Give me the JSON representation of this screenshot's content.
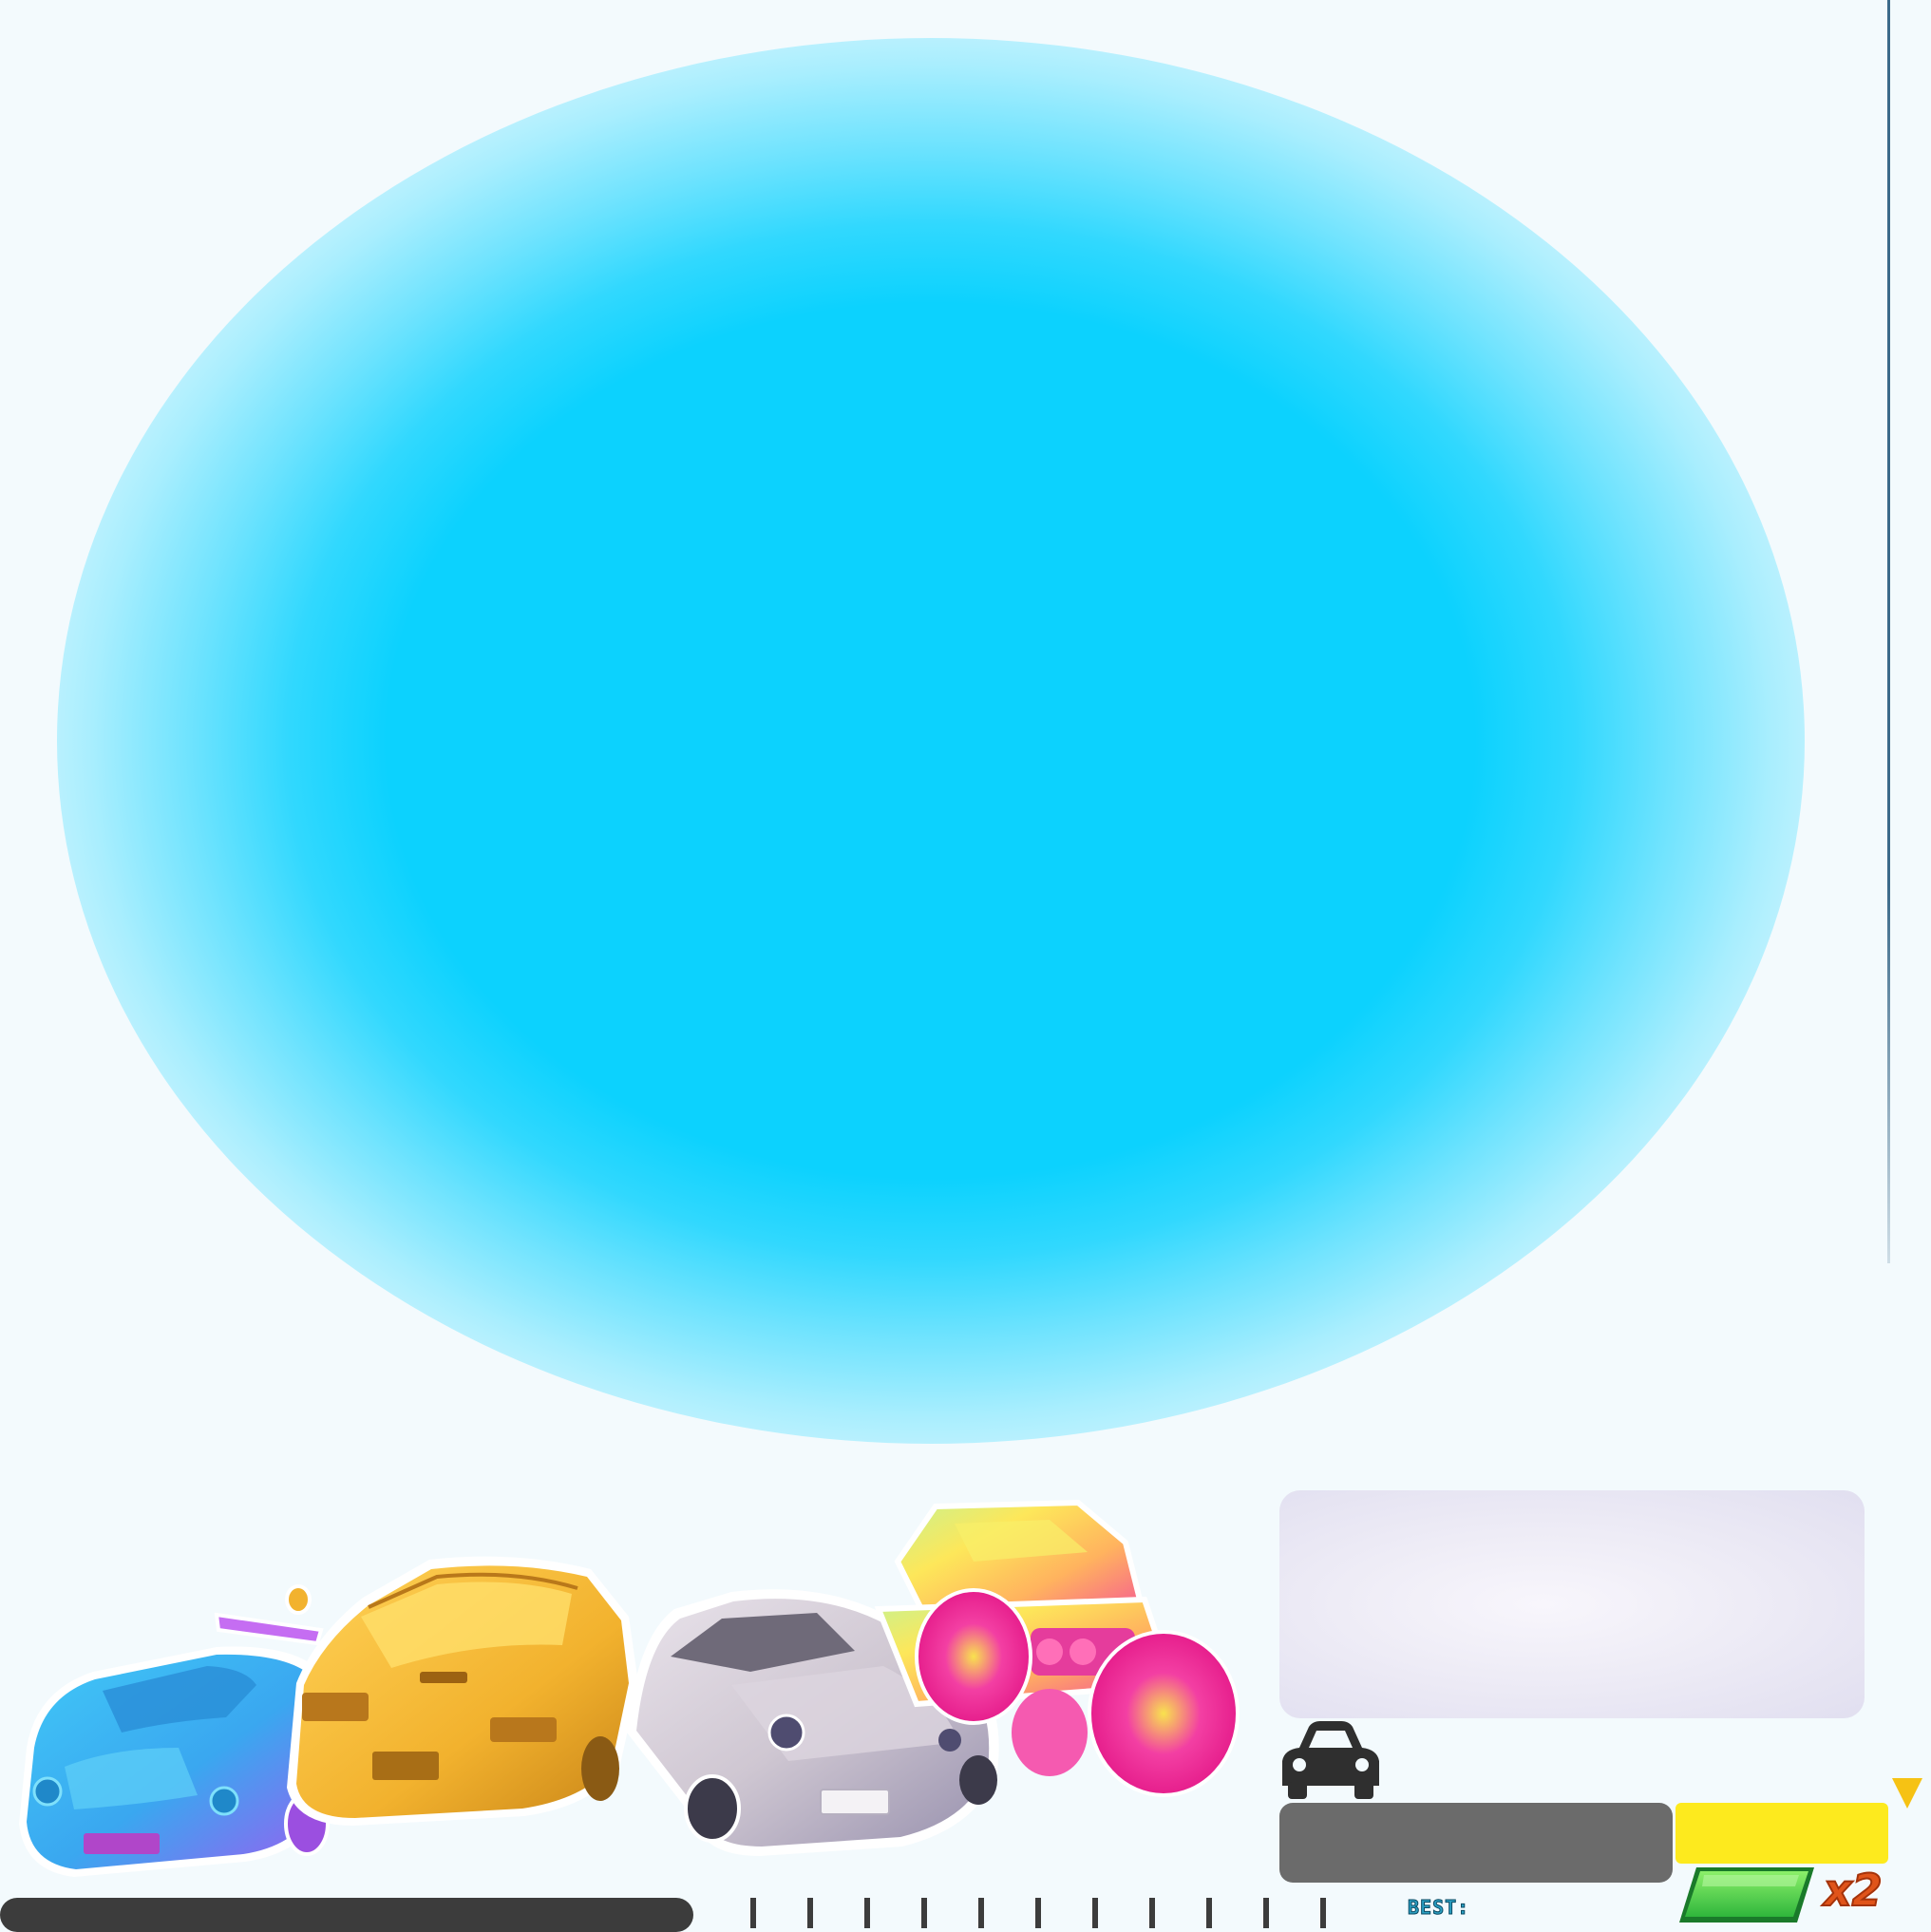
{
  "hud": {
    "best_label": "BEST:",
    "multiplier_label": "x2"
  },
  "icons": {
    "car": "car-icon",
    "marker": "triangle-down-icon",
    "boost": "green-parallelogram-button"
  },
  "colors": {
    "glow": "#0cd2fe",
    "background": "#f3fafd",
    "progress_track": "#3c3c3c",
    "gray_bar": "#6b6b6b",
    "yellow_bar": "#fdea1e",
    "marker": "#f6c214",
    "boost_button": "#3fd24c",
    "multiplier": "#e0541a"
  },
  "cars": [
    {
      "name": "blue-purple-sports-car",
      "color": "#38b6f2"
    },
    {
      "name": "gold-muscle-car",
      "color": "#f2b22e"
    },
    {
      "name": "silver-coupe",
      "color": "#cfc7d2"
    },
    {
      "name": "rainbow-monster-truck",
      "color": "#f33fa3"
    }
  ],
  "progress": {
    "tick_count": 11
  }
}
